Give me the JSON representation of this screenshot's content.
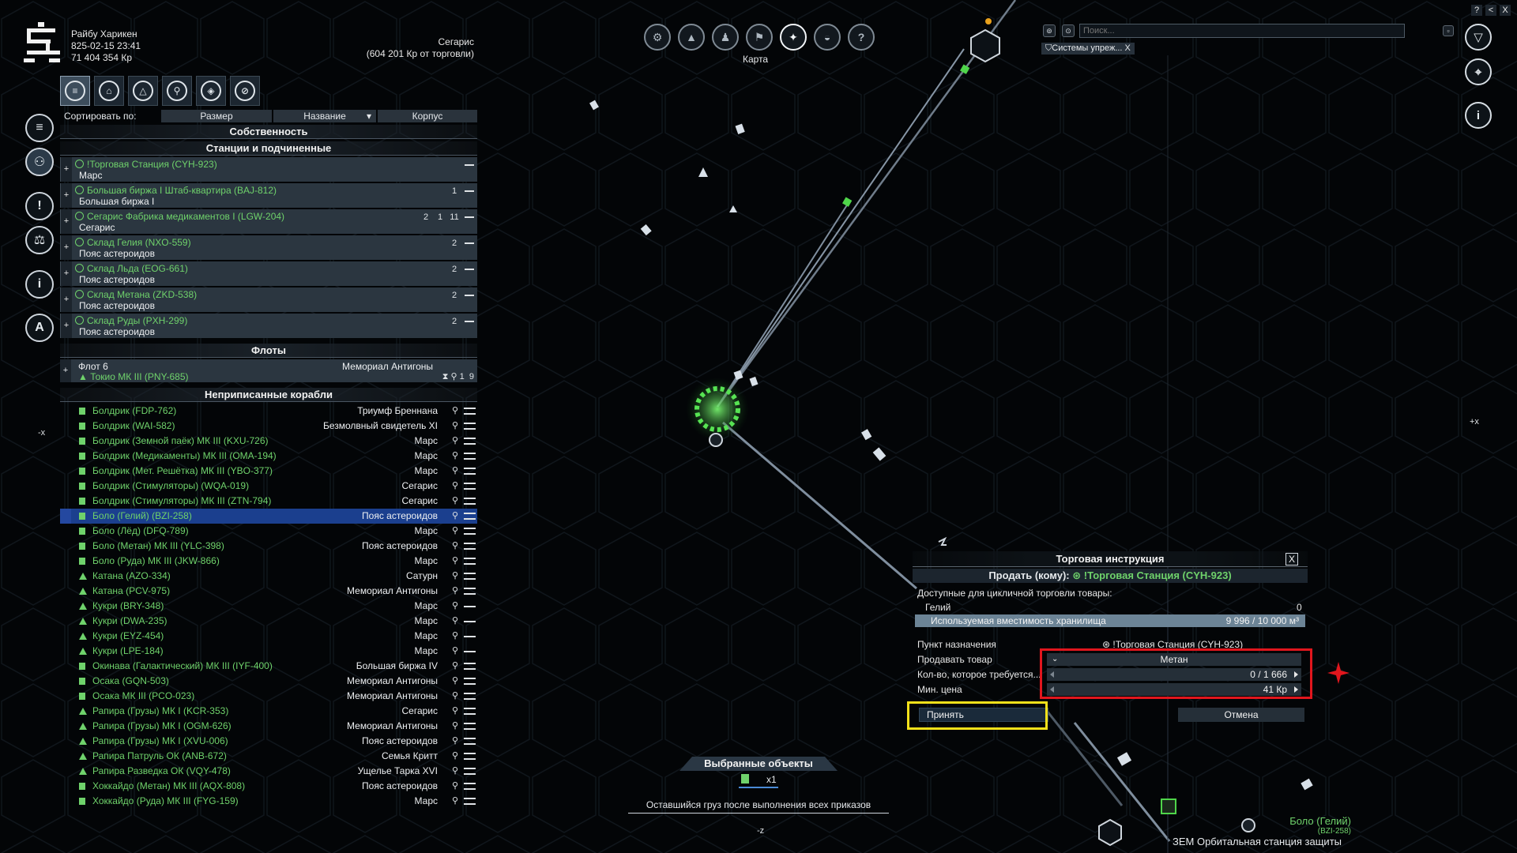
{
  "player": {
    "name": "Райбу Харикен",
    "datetime": "825-02-15 23:41",
    "credits": "71 404 354 Кр"
  },
  "sector": {
    "name": "Сегарис",
    "trade_income": "(604 201 Кр от торговли)"
  },
  "left_menu": [
    "menu-icon",
    "property-icon",
    "alert-icon",
    "economy-icon",
    "info-icon",
    "ship-icon"
  ],
  "property_tabs": [
    "all",
    "stations",
    "fleets",
    "unassigned",
    "deployables",
    "filter-off"
  ],
  "sort": {
    "label": "Сортировать по:",
    "buttons": [
      "Размер",
      "Название",
      "Корпус"
    ]
  },
  "panel": {
    "title": "Собственность",
    "stations_header": "Станции и подчиненные",
    "fleets_header": "Флоты",
    "unassigned_header": "Неприписанные корабли"
  },
  "stations": [
    {
      "name": "!Торговая Станция  (CYH-923)",
      "sector": "Марс",
      "counts": []
    },
    {
      "name": "Большая биржа I Штаб-квартира (BAJ-812)",
      "sector": "Большая биржа I",
      "counts": [
        "1"
      ]
    },
    {
      "name": "Сегарис Фабрика медикаментов I (LGW-204)",
      "sector": "Сегарис",
      "counts": [
        "2",
        "1",
        "11"
      ]
    },
    {
      "name": "Склад Гелия (NXO-559)",
      "sector": "Пояс астероидов",
      "counts": [
        "2"
      ]
    },
    {
      "name": "Склад Льда (EOG-661)",
      "sector": "Пояс астероидов",
      "counts": [
        "2"
      ]
    },
    {
      "name": "Склад Метана (ZKD-538)",
      "sector": "Пояс астероидов",
      "counts": [
        "2"
      ]
    },
    {
      "name": "Склад Руды (PXH-299)",
      "sector": "Пояс астероидов",
      "counts": [
        "2"
      ]
    }
  ],
  "fleet": {
    "name": "Флот 6",
    "commander": "Токио МК III (PNY-685)",
    "location": "Мемориал Антигоны",
    "counts": [
      "1",
      "9"
    ]
  },
  "ships": [
    {
      "name": "Болдрик (FDP-762)",
      "location": "Триумф Бреннана"
    },
    {
      "name": "Болдрик (WAI-582)",
      "location": "Безмолвный свидетель XI"
    },
    {
      "name": "Болдрик (Земной паёк) МК III (KXU-726)",
      "location": "Марс"
    },
    {
      "name": "Болдрик (Медикаменты) МК III (OMA-194)",
      "location": "Марс"
    },
    {
      "name": "Болдрик (Мет. Решётка) МК III (YBO-377)",
      "location": "Марс"
    },
    {
      "name": "Болдрик (Стимуляторы) (WQA-019)",
      "location": "Сегарис"
    },
    {
      "name": "Болдрик (Стимуляторы) МК III  (ZTN-794)",
      "location": "Сегарис"
    },
    {
      "name": "Боло (Гелий)  (BZI-258)",
      "location": "Пояс астероидов",
      "selected": true
    },
    {
      "name": "Боло (Лёд) (DFQ-789)",
      "location": "Марс"
    },
    {
      "name": "Боло (Метан) МК III (YLC-398)",
      "location": "Пояс астероидов"
    },
    {
      "name": "Боло (Руда) МК III (JKW-866)",
      "location": "Марс"
    },
    {
      "name": "Катана (AZO-334)",
      "location": "Сатурн"
    },
    {
      "name": "Катана (PCV-975)",
      "location": "Мемориал Антигоны"
    },
    {
      "name": "Кукри (BRY-348)",
      "location": "Марс"
    },
    {
      "name": "Кукри (DWA-235)",
      "location": "Марс"
    },
    {
      "name": "Кукри (EYZ-454)",
      "location": "Марс"
    },
    {
      "name": "Кукри (LPE-184)",
      "location": "Марс"
    },
    {
      "name": "Окинава (Галактический) МК III  (IYF-400)",
      "location": "Большая биржа IV"
    },
    {
      "name": "Осака (GQN-503)",
      "location": "Мемориал Антигоны"
    },
    {
      "name": "Осака МК III (PCO-023)",
      "location": "Мемориал Антигоны"
    },
    {
      "name": "Рапира (Грузы) МК I (KCR-353)",
      "location": "Сегарис"
    },
    {
      "name": "Рапира (Грузы) МК I (OGM-626)",
      "location": "Мемориал Антигоны"
    },
    {
      "name": "Рапира (Грузы) МК I (XVU-006)",
      "location": "Пояс астероидов"
    },
    {
      "name": "Рапира Патруль ОК (ANB-672)",
      "location": "Семья Критт"
    },
    {
      "name": "Рапира Разведка ОК (VQY-478)",
      "location": "Ущелье Тарка XVI"
    },
    {
      "name": "Хоккайдо (Метан) МК III (AQX-808)",
      "location": "Пояс астероидов"
    },
    {
      "name": "Хоккайдо (Руда) МК III (FYG-159)",
      "location": "Марс"
    }
  ],
  "top_toolbar": {
    "buttons": [
      "settings-icon",
      "ship-menu-icon",
      "player-icon",
      "empire-icon",
      "map-icon",
      "encyclopedia-icon",
      "help-icon"
    ],
    "active_caption": "Карта"
  },
  "search": {
    "placeholder": "Поиск...",
    "filter_chip": "Системы упреж... X"
  },
  "corner_buttons": [
    "?",
    "<",
    "X"
  ],
  "right_menu": [
    "filter-icon",
    "location-icon",
    "info-icon"
  ],
  "edge_marks": {
    "left": "-x",
    "right": "+x",
    "bottom": "-z"
  },
  "trade_dialog": {
    "title": "Торговая инструкция",
    "close": "X",
    "sell_to_label": "Продать (кому):",
    "sell_to_target": "!Торговая Станция  (CYH-923)",
    "available_label": "Доступные для цикличной торговли товары:",
    "ware_name": "Гелий",
    "ware_amount": "0",
    "capacity_label": "Используемая вместимость хранилища",
    "capacity_value": "9 996 / 10 000 м³",
    "capacity_fraction": 0.9996,
    "destination_label": "Пункт назначения",
    "destination_value": "!Торговая Станция  (CYH-923)",
    "ware_label": "Продавать товар",
    "ware_value": "Метан",
    "amount_label": "Кол-во, которое требуется...",
    "amount_value": "0 / 1 666",
    "price_label": "Мин. цена",
    "price_value": "41 Кр",
    "accept": "Принять",
    "cancel": "Отмена"
  },
  "selected_objects": {
    "title": "Выбранные объекты",
    "count": "x1",
    "note": "Оставшийся груз после выполнения всех приказов"
  },
  "target": {
    "name": "Боло (Гелий)",
    "code": "(BZI-258)",
    "station_label": "ЗЕМ Орбитальная станция защиты"
  }
}
